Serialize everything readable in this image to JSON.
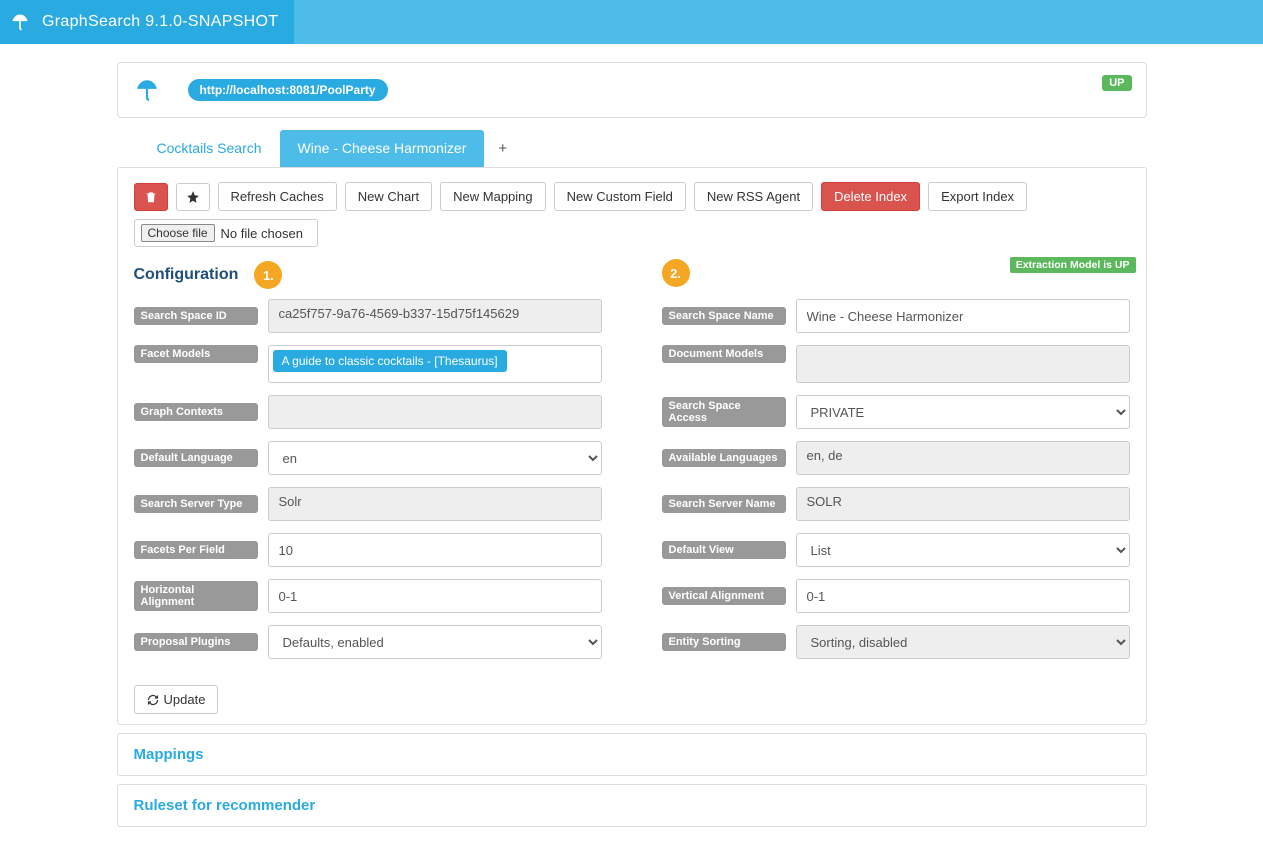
{
  "app": {
    "title": "GraphSearch 9.1.0-SNAPSHOT"
  },
  "header": {
    "endpoint": "http://localhost:8081/PoolParty",
    "status_badge": "UP"
  },
  "tabs": {
    "items": [
      "Cocktails Search",
      "Wine - Cheese Harmonizer"
    ],
    "active_index": 1,
    "plus": "+"
  },
  "toolbar": {
    "refresh": "Refresh Caches",
    "new_chart": "New Chart",
    "new_mapping": "New Mapping",
    "new_custom_field": "New Custom Field",
    "new_rss_agent": "New RSS Agent",
    "delete_index": "Delete Index",
    "export_index": "Export Index",
    "choose_file": "Choose file",
    "no_file": "No file chosen"
  },
  "section": {
    "title": "Configuration",
    "marker1": "1.",
    "marker2": "2.",
    "model_badge": "Extraction Model is UP",
    "update": "Update"
  },
  "labels": {
    "search_space_id": "Search Space ID",
    "facet_models": "Facet Models",
    "graph_contexts": "Graph Contexts",
    "default_language": "Default Language",
    "search_server_type": "Search Server Type",
    "facets_per_field": "Facets Per Field",
    "horizontal_alignment": "Horizontal Alignment",
    "proposal_plugins": "Proposal Plugins",
    "search_space_name": "Search Space Name",
    "document_models": "Document Models",
    "search_space_access": "Search Space Access",
    "available_languages": "Available Languages",
    "search_server_name": "Search Server Name",
    "default_view": "Default View",
    "vertical_alignment": "Vertical Alignment",
    "entity_sorting": "Entity Sorting"
  },
  "values": {
    "search_space_id": "ca25f757-9a76-4569-b337-15d75f145629",
    "facet_model_tag": "A guide to classic cocktails - [Thesaurus]",
    "graph_contexts": "",
    "default_language": "en",
    "search_server_type": "Solr",
    "facets_per_field": "10",
    "horizontal_alignment": "0-1",
    "proposal_plugins": "Defaults, enabled",
    "search_space_name": "Wine - Cheese Harmonizer",
    "document_models": "",
    "search_space_access": "PRIVATE",
    "available_languages": "en, de",
    "search_server_name": "SOLR",
    "default_view": "List",
    "vertical_alignment": "0-1",
    "entity_sorting": "Sorting, disabled"
  },
  "collapsed": {
    "mappings": "Mappings",
    "ruleset": "Ruleset for recommender"
  }
}
